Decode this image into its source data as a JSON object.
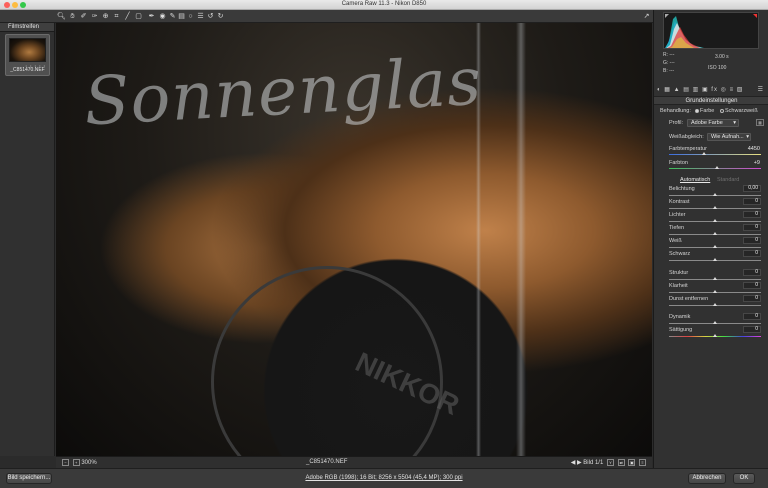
{
  "window": {
    "title": "Camera Raw 11.3  -  Nikon D850"
  },
  "toolbar": {
    "tools": [
      "zoom-icon",
      "hand-icon",
      "white-balance-icon",
      "color-sampler-icon",
      "targeted-adjustment-icon",
      "crop-icon",
      "straighten-icon",
      "transform-icon",
      "spot-removal-icon",
      "red-eye-icon",
      "adjustment-brush-icon",
      "graduated-filter-icon",
      "radial-filter-icon",
      "preferences-icon",
      "rotate-left-icon",
      "rotate-right-icon"
    ],
    "fullscreen_icon": "fullscreen-icon"
  },
  "filmstrip": {
    "header": "Filmstreifen",
    "thumb_name": "_C851470.NEF",
    "rating_dots": "• • • • •"
  },
  "canvas": {
    "glass_text": "Sonnenglas",
    "cap_text": "NIKKOR"
  },
  "status": {
    "zoom": "300%",
    "filename": "_C851470.NEF",
    "page": "Bild 1/1"
  },
  "histogram": {
    "r_label": "R:",
    "g_label": "G:",
    "b_label": "B:",
    "r_value": "---",
    "g_value": "---",
    "b_value": "---",
    "exposure_time": "3.00 s",
    "iso": "ISO 100"
  },
  "basic": {
    "section_title": "Grundeinstellungen",
    "behandlung_label": "Behandlung:",
    "farbe_label": "Farbe",
    "sw_label": "Schwarzweiß",
    "profil_label": "Profil:",
    "profil_value": "Adobe Farbe",
    "weissabgleich_label": "Weißabgleich:",
    "weissabgleich_value": "Wie Aufnah...",
    "farbtemperatur_label": "Farbtemperatur",
    "farbtemperatur_value": "4450",
    "farbton_label": "Farbton",
    "farbton_value": "+9",
    "auto_label": "Automatisch",
    "standard_label": "Standard",
    "sliders": [
      {
        "label": "Belichtung",
        "value": "0,00"
      },
      {
        "label": "Kontrast",
        "value": "0"
      },
      {
        "label": "Lichter",
        "value": "0"
      },
      {
        "label": "Tiefen",
        "value": "0"
      },
      {
        "label": "Weiß",
        "value": "0"
      },
      {
        "label": "Schwarz",
        "value": "0"
      },
      {
        "label": "Struktur",
        "value": "0"
      },
      {
        "label": "Klarheit",
        "value": "0"
      },
      {
        "label": "Dunst entfernen",
        "value": "0"
      },
      {
        "label": "Dynamik",
        "value": "0"
      },
      {
        "label": "Sättigung",
        "value": "0"
      }
    ]
  },
  "bottom": {
    "save_label": "Bild speichern...",
    "info": "Adobe RGB (1998); 16 Bit; 8256 x 5504 (45,4 MP); 300 ppi",
    "cancel_label": "Abbrechen",
    "ok_label": "OK"
  }
}
